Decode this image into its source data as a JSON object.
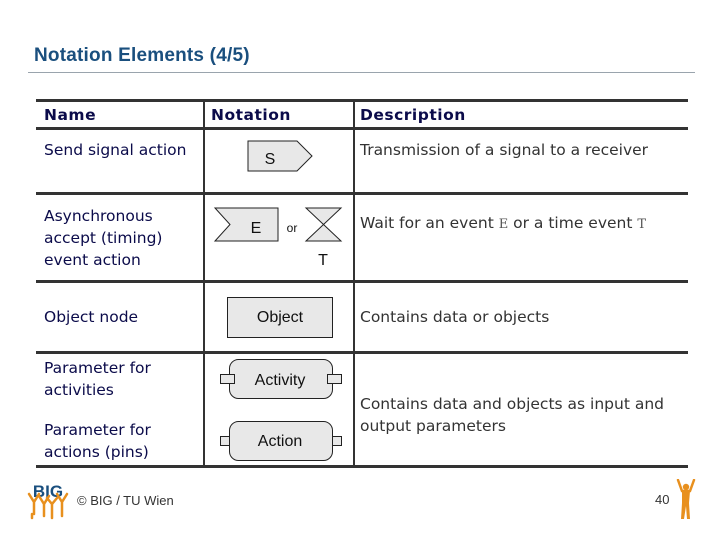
{
  "slide": {
    "title": "Notation Elements (4/5)",
    "page_number": "40",
    "footer": "© BIG / TU Wien",
    "logo_text": "BIG"
  },
  "table": {
    "headers": {
      "name": "Name",
      "notation": "Notation",
      "description": "Description"
    },
    "rows": [
      {
        "name": "Send signal action",
        "notation_label": "S",
        "description": "Transmission of a signal to a receiver"
      },
      {
        "name": "Asynchronous accept (timing) event action",
        "notation_label": "E",
        "notation_or": "or",
        "notation_label2": "T",
        "description_pre": "Wait for an event ",
        "description_e": "E",
        "description_mid": " or a time event ",
        "description_t": "T"
      },
      {
        "name": "Object node",
        "notation_label": "Object",
        "description": "Contains data or objects"
      },
      {
        "name": "Parameter for activities",
        "notation_label": "Activity"
      },
      {
        "name": "Parameter for actions (pins)",
        "notation_label": "Action"
      }
    ],
    "shared_description": "Contains data and objects as input and output parameters"
  },
  "colors": {
    "title": "#1a4f7e",
    "shape_fill": "#e8e8e8",
    "logo_orange": "#e8901e",
    "logo_blue": "#1a4f7e"
  }
}
